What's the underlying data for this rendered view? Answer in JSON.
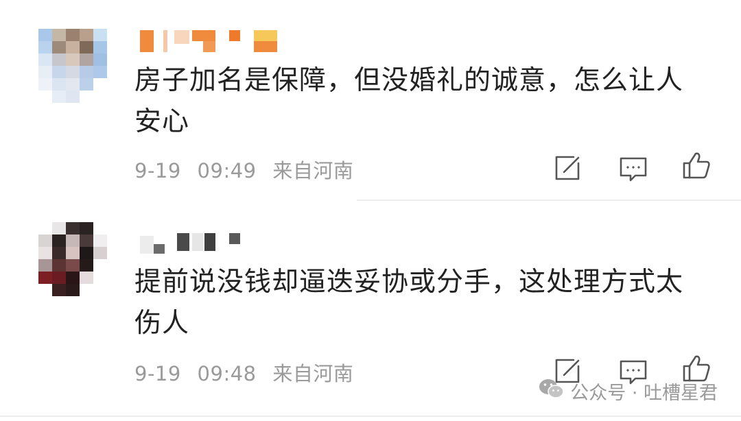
{
  "comments": [
    {
      "text": "房子加名是保障，但没婚礼的诚意，怎么让人\n安心",
      "date": "9-19",
      "time": "09:49",
      "location": "来自河南"
    },
    {
      "text": "提前说没钱却逼迭妥协或分手，这处理方式太\n伤人",
      "date": "9-19",
      "time": "09:48",
      "location": "来自河南"
    }
  ],
  "actions": {
    "repost_icon": "share-edit-icon",
    "comment_icon": "comment-icon",
    "like_icon": "thumbs-up-icon"
  },
  "watermark": {
    "text": "公众号 · 吐槽星君",
    "icon": "wechat-icon"
  },
  "colors": {
    "text": "#222222",
    "meta": "#9a9a9a",
    "icon": "#555555",
    "divider": "#eeeeee"
  }
}
